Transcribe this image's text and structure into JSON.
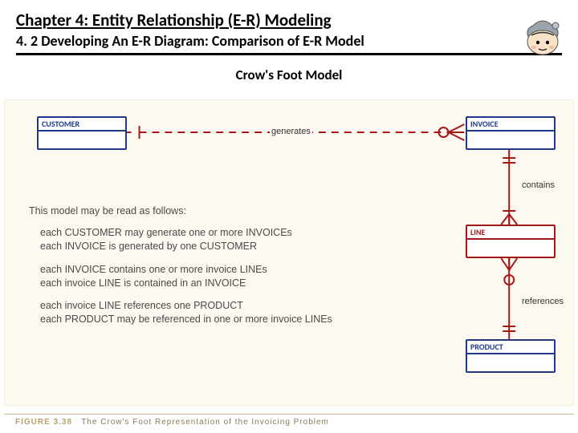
{
  "header": {
    "chapter_title": "Chapter 4: Entity Relationship (E-R) Modeling",
    "section_title": "4. 2 Developing An E-R Diagram: Comparison of E-R Model"
  },
  "figure": {
    "display_title": "Crow's Foot Model",
    "entities": {
      "customer": "CUSTOMER",
      "invoice": "INVOICE",
      "line": "LINE",
      "product": "PRODUCT"
    },
    "relationships": {
      "generates": "generates",
      "contains": "contains",
      "references": "references"
    },
    "caption_label": "FIGURE 3.38",
    "caption_text": "The Crow's Foot Representation of the Invoicing Problem"
  },
  "explanation": {
    "heading": "This model may be read as follows:",
    "lines": {
      "l1": "each CUSTOMER may generate one or more INVOICEs",
      "l2": "each INVOICE is generated by one CUSTOMER",
      "l3": "each INVOICE contains one or more invoice LINEs",
      "l4": "each invoice LINE is contained in an INVOICE",
      "l5": "each invoice LINE references one PRODUCT",
      "l6": "each PRODUCT may be referenced in one or more invoice LINEs"
    }
  },
  "chart_data": {
    "type": "er-diagram",
    "notation": "crows-foot",
    "entities": [
      "CUSTOMER",
      "INVOICE",
      "LINE",
      "PRODUCT"
    ],
    "relationships": [
      {
        "from": "CUSTOMER",
        "to": "INVOICE",
        "name": "generates",
        "from_card": "1..1",
        "to_card": "0..*",
        "optional_at": "from"
      },
      {
        "from": "INVOICE",
        "to": "LINE",
        "name": "contains",
        "from_card": "1..1",
        "to_card": "1..*"
      },
      {
        "from": "LINE",
        "to": "PRODUCT",
        "name": "references",
        "from_card": "0..*",
        "to_card": "1..1",
        "optional_at": "to"
      }
    ]
  }
}
